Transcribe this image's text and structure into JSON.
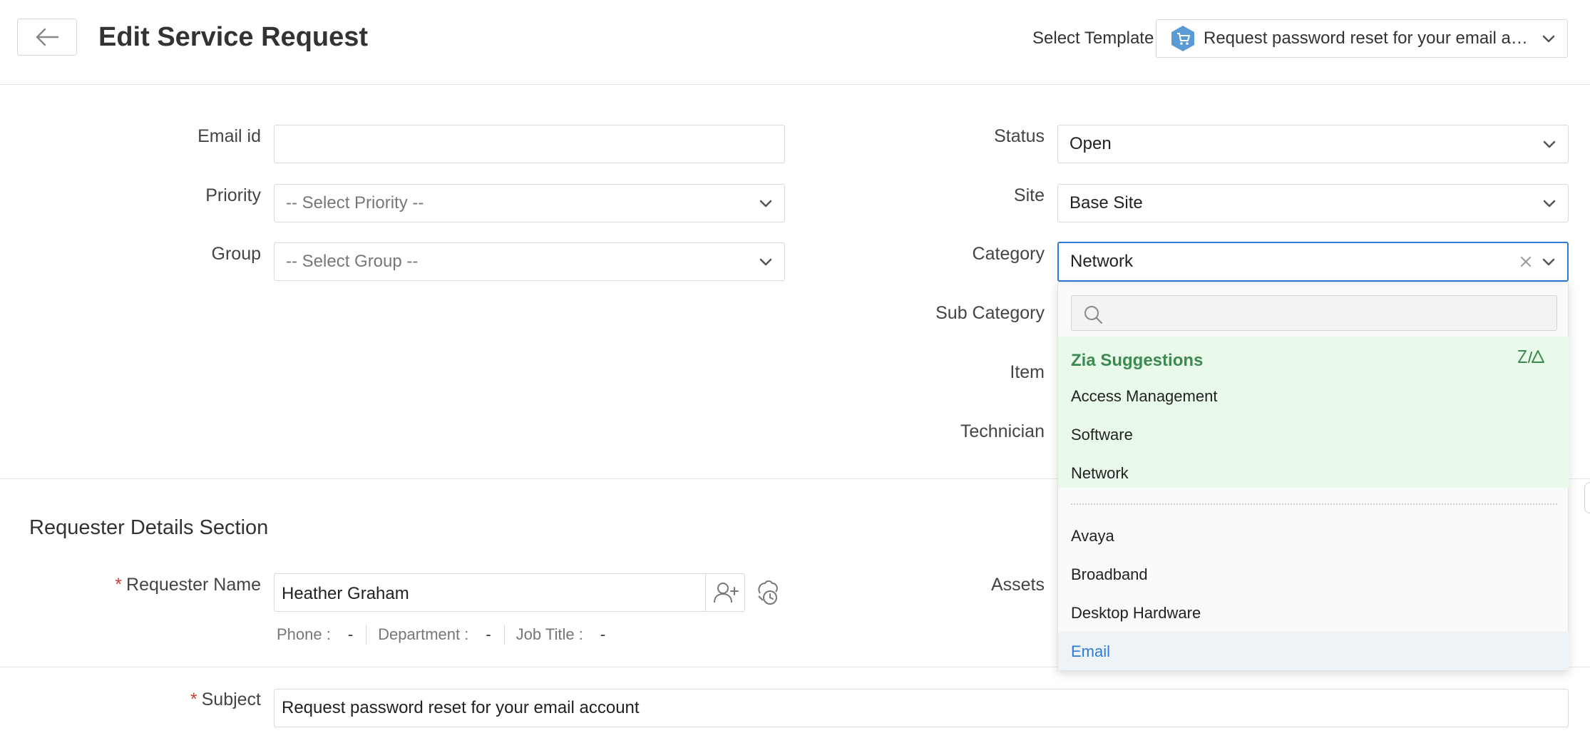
{
  "header": {
    "title": "Edit Service Request",
    "select_template_label": "Select Template",
    "template_value": "Request password reset for your email account",
    "template_icon": "cart-hexagon-icon",
    "template_icon_color": "#5b9bd5"
  },
  "form": {
    "email_label": "Email id",
    "email_value": "",
    "priority_label": "Priority",
    "priority_placeholder": "-- Select Priority --",
    "group_label": "Group",
    "group_placeholder": "-- Select Group --",
    "status_label": "Status",
    "status_value": "Open",
    "site_label": "Site",
    "site_value": "Base Site",
    "category_label": "Category",
    "category_value": "Network",
    "subcategory_label": "Sub Category",
    "item_label": "Item",
    "technician_label": "Technician"
  },
  "category_dropdown": {
    "search_placeholder": "",
    "zia_title": "Zia Suggestions",
    "zia_items": [
      "Access Management",
      "Software",
      "Network"
    ],
    "items": [
      "Avaya",
      "Broadband",
      "Desktop Hardware",
      "Email"
    ],
    "highlighted_item": "Email",
    "colors": {
      "zia_bg": "#eafaea",
      "zia_text": "#3d8a51",
      "highlight_text": "#2f7ad9",
      "focus_border": "#2f7ad9"
    }
  },
  "requester": {
    "section_title": "Requester Details Section",
    "name_label": "Requester Name",
    "required_mark": "*",
    "name_value": "Heather Graham",
    "phone_label": "Phone :",
    "phone_value": "-",
    "department_label": "Department :",
    "department_value": "-",
    "job_title_label": "Job Title :",
    "job_title_value": "-",
    "assets_label": "Assets"
  },
  "subject": {
    "label": "Subject",
    "required_mark": "*",
    "value": "Request password reset for your email account"
  }
}
